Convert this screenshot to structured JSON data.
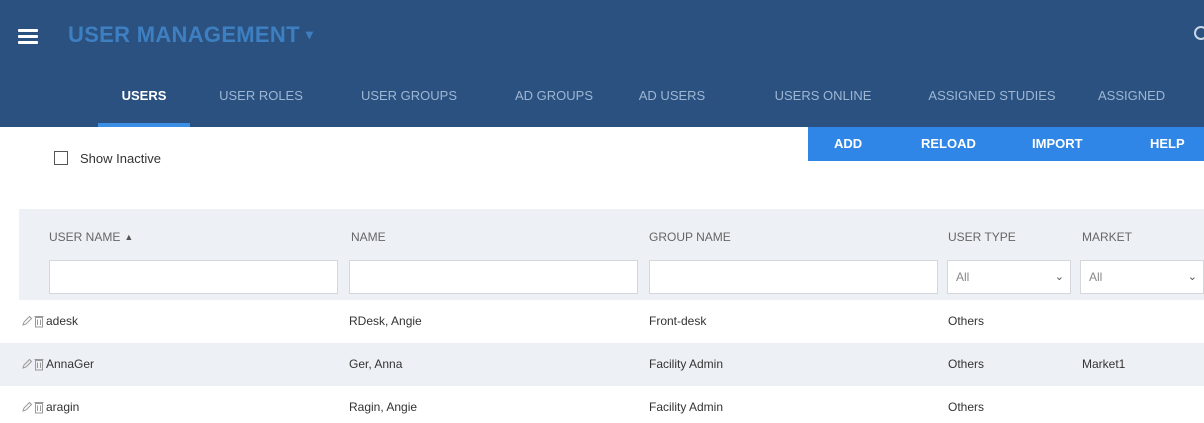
{
  "header": {
    "title": "USER MANAGEMENT",
    "title_caret": "▾",
    "hamburger_icon": "hamburger-icon"
  },
  "tabs": [
    {
      "label": "USERS",
      "active": true
    },
    {
      "label": "USER ROLES",
      "active": false
    },
    {
      "label": "USER GROUPS",
      "active": false
    },
    {
      "label": "AD GROUPS",
      "active": false
    },
    {
      "label": "AD USERS",
      "active": false
    },
    {
      "label": "USERS ONLINE",
      "active": false
    },
    {
      "label": "ASSIGNED STUDIES",
      "active": false
    },
    {
      "label": "ASSIGNED",
      "active": false
    }
  ],
  "actions": {
    "add": "ADD",
    "reload": "RELOAD",
    "import": "IMPORT",
    "help": "HELP"
  },
  "filters": {
    "show_inactive_label": "Show Inactive",
    "show_inactive_checked": false
  },
  "table": {
    "columns": {
      "user_name": "USER NAME",
      "name": "NAME",
      "group_name": "GROUP NAME",
      "user_type": "USER TYPE",
      "market": "MARKET"
    },
    "user_type_filter": "All",
    "market_filter": "All",
    "rows": [
      {
        "user_name": "adesk",
        "name": "RDesk, Angie",
        "group_name": "Front-desk",
        "user_type": "Others",
        "market": ""
      },
      {
        "user_name": "AnnaGer",
        "name": "Ger, Anna",
        "group_name": "Facility Admin",
        "user_type": "Others",
        "market": "Market1"
      },
      {
        "user_name": "aragin",
        "name": "Ragin, Angie",
        "group_name": "Facility Admin",
        "user_type": "Others",
        "market": ""
      }
    ]
  },
  "colors": {
    "header_bg": "#2b5180",
    "title": "#3d7fc1",
    "tab_inactive": "#9db6d3",
    "tab_underline": "#3a8ee6",
    "action_bar": "#2f86e6",
    "grid_head_bg": "#edf0f4"
  }
}
